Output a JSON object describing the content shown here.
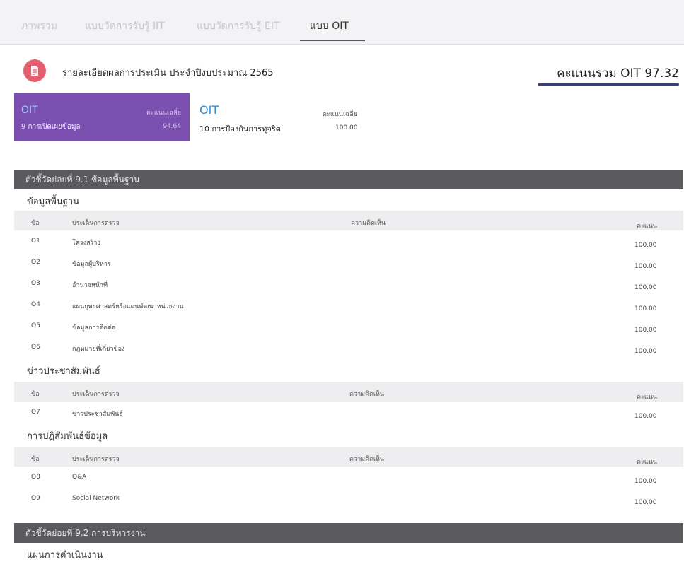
{
  "tabs": [
    {
      "label": "ภาพรวม",
      "active": false
    },
    {
      "label": "แบบวัดการรับรู้ IIT",
      "active": false
    },
    {
      "label": "แบบวัดการรับรู้ EIT",
      "active": false
    },
    {
      "label": "แบบ OIT",
      "active": true
    }
  ],
  "report": {
    "icon": "document-icon",
    "title": "รายละเอียดผลการประเมิน ประจำปีงบประมาณ 2565",
    "total_score": "คะแนนรวม OIT 97.32"
  },
  "cards": [
    {
      "category": "OIT",
      "avg_label": "คะแนนเฉลี่ย",
      "name": "9 การเปิดเผยข้อมูล",
      "score": "94.64"
    },
    {
      "category": "OIT",
      "avg_label": "คะแนนเฉลี่ย",
      "name": "10 การป้องกันการทุจริต",
      "score": "100.00"
    }
  ],
  "table": {
    "col_no": "ข้อ",
    "col_item": "ประเด็นการตรวจ",
    "col_comment": "ความคิดเห็น",
    "col_score": "คะแนน"
  },
  "sections": [
    {
      "header": "ตัวชี้วัดย่อยที่ 9.1 ข้อมูลพื้นฐาน"
    },
    {
      "header": "ตัวชี้วัดย่อยที่ 9.2 การบริหารงาน"
    }
  ],
  "groups": [
    {
      "title": "ข้อมูลพื้นฐาน",
      "rows": [
        {
          "no": "O1",
          "item": "โครงสร้าง",
          "score": "100.00"
        },
        {
          "no": "O2",
          "item": "ข้อมูลผู้บริหาร",
          "score": "100.00"
        },
        {
          "no": "O3",
          "item": "อำนาจหน้าที่",
          "score": "100.00"
        },
        {
          "no": "O4",
          "item": "แผนยุทธศาสตร์หรือแผนพัฒนาหน่วยงาน",
          "score": "100.00"
        },
        {
          "no": "O5",
          "item": "ข้อมูลการติดต่อ",
          "score": "100.00"
        },
        {
          "no": "O6",
          "item": "กฎหมายที่เกี่ยวข้อง",
          "score": "100.00"
        }
      ]
    },
    {
      "title": "ข่าวประชาสัมพันธ์",
      "rows": [
        {
          "no": "O7",
          "item": "ข่าวประชาสัมพันธ์",
          "score": "100.00"
        }
      ]
    },
    {
      "title": "การปฏิสัมพันธ์ข้อมูล",
      "rows": [
        {
          "no": "O8",
          "item": "Q&A",
          "score": "100.00"
        },
        {
          "no": "O9",
          "item": "Social Network",
          "score": "100.00"
        }
      ]
    },
    {
      "title": "แผนการดำเนินงาน",
      "rows": []
    }
  ],
  "colors": {
    "purple_card": "#7b4fb0",
    "oit_blue": "#2f8fd6",
    "section_header": "#5b5b5f",
    "icon_red": "#e4606e",
    "underline_navy": "#3a3f6b"
  }
}
